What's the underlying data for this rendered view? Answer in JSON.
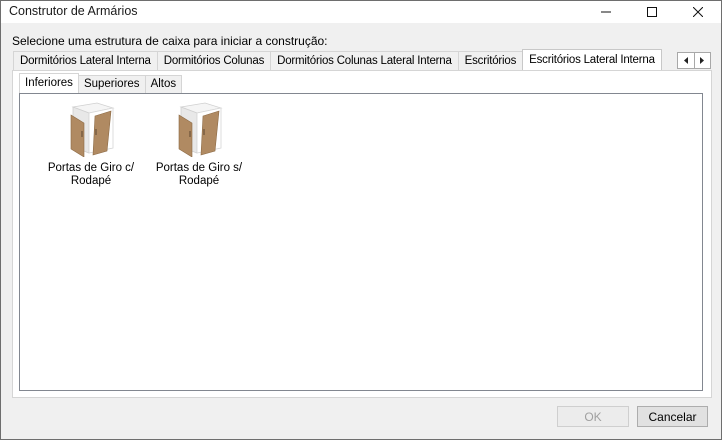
{
  "window": {
    "title": "Construtor de Armários"
  },
  "prompt": "Selecione uma estrutura de caixa para iniciar a construção:",
  "tabs": [
    {
      "label": "Dormitórios Lateral Interna",
      "active": false
    },
    {
      "label": "Dormitórios Colunas",
      "active": false
    },
    {
      "label": "Dormitórios Colunas Lateral Interna",
      "active": false
    },
    {
      "label": "Escritórios",
      "active": false
    },
    {
      "label": "Escritórios Lateral Interna",
      "active": true
    }
  ],
  "subtabs": [
    {
      "label": "Inferiores",
      "active": true
    },
    {
      "label": "Superiores",
      "active": false
    },
    {
      "label": "Altos",
      "active": false
    }
  ],
  "items": [
    {
      "line1": "Portas de Giro c/",
      "line2": "Rodapé",
      "icon": "cabinet-doors-icon"
    },
    {
      "line1": "Portas de Giro s/",
      "line2": "Rodapé",
      "icon": "cabinet-doors-icon"
    }
  ],
  "buttons": {
    "ok": "OK",
    "ok_enabled": false,
    "cancel": "Cancelar"
  },
  "colors": {
    "wood": "#b08a62",
    "wood_dark": "#8c6a45",
    "panel": "#ffffff",
    "cabinet_top": "#f4f4f4"
  }
}
